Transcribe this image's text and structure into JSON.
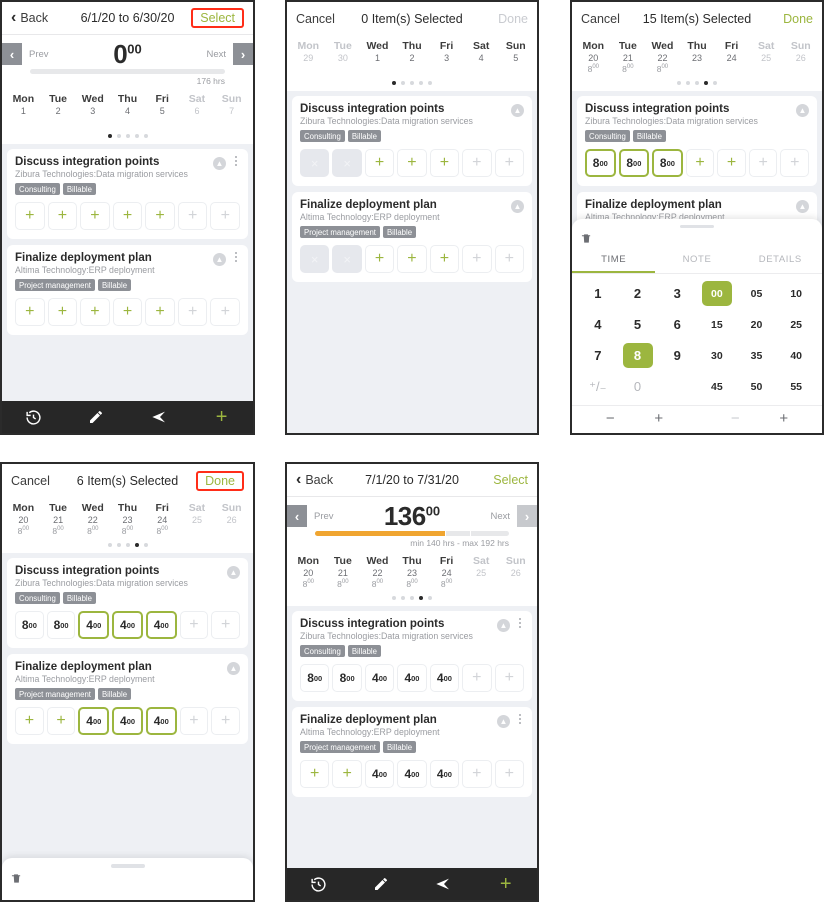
{
  "colors": {
    "accent": "#9cb63f",
    "orange": "#f0a530",
    "gray": "#8d9096",
    "dark": "#272727",
    "highlight": "#ff2d18"
  },
  "tasks": {
    "t1": {
      "title": "Discuss integration points",
      "subtitle": "Zibura Technologies:Data migration services",
      "tags": [
        "Consulting",
        "Billable"
      ]
    },
    "t2": {
      "title": "Finalize deployment plan",
      "subtitle": "Altima Technology:ERP deployment",
      "tags": [
        "Project management",
        "Billable"
      ]
    }
  },
  "panel1": {
    "nav": {
      "back": "Back",
      "title": "6/1/20 to 6/30/20",
      "action": "Select"
    },
    "summary": {
      "prev": "Prev",
      "next": "Next",
      "hours": "0",
      "minutes": "00",
      "caption": "176 hrs",
      "fill_pct": 0
    },
    "weekdays": [
      {
        "day": "Mon",
        "date": "1",
        "hours": "",
        "dim": false
      },
      {
        "day": "Tue",
        "date": "2",
        "hours": "",
        "dim": false
      },
      {
        "day": "Wed",
        "date": "3",
        "hours": "",
        "dim": false
      },
      {
        "day": "Thu",
        "date": "4",
        "hours": "",
        "dim": false
      },
      {
        "day": "Fri",
        "date": "5",
        "hours": "",
        "dim": false
      },
      {
        "day": "Sat",
        "date": "6",
        "hours": "",
        "dim": true
      },
      {
        "day": "Sun",
        "date": "7",
        "hours": "",
        "dim": true
      }
    ],
    "dots": {
      "count": 5,
      "active": 0
    },
    "card1_cells": [
      {
        "type": "plus"
      },
      {
        "type": "plus"
      },
      {
        "type": "plus"
      },
      {
        "type": "plus"
      },
      {
        "type": "plus"
      },
      {
        "type": "plus-mute"
      },
      {
        "type": "plus-mute"
      }
    ],
    "card2_cells": [
      {
        "type": "plus"
      },
      {
        "type": "plus"
      },
      {
        "type": "plus"
      },
      {
        "type": "plus"
      },
      {
        "type": "plus"
      },
      {
        "type": "plus-mute"
      },
      {
        "type": "plus-mute"
      }
    ]
  },
  "panel2": {
    "nav": {
      "cancel": "Cancel",
      "title": "0 Item(s) Selected",
      "done": "Done"
    },
    "weekdays": [
      {
        "day": "Mon",
        "date": "29",
        "hours": "",
        "dim": true
      },
      {
        "day": "Tue",
        "date": "30",
        "hours": "",
        "dim": true
      },
      {
        "day": "Wed",
        "date": "1",
        "hours": "",
        "dim": false
      },
      {
        "day": "Thu",
        "date": "2",
        "hours": "",
        "dim": false
      },
      {
        "day": "Fri",
        "date": "3",
        "hours": "",
        "dim": false
      },
      {
        "day": "Sat",
        "date": "4",
        "hours": "",
        "dim": false
      },
      {
        "day": "Sun",
        "date": "5",
        "hours": "",
        "dim": false
      }
    ],
    "dots": {
      "count": 5,
      "active": 0
    },
    "card1_cells": [
      {
        "type": "disabled",
        "label": "×"
      },
      {
        "type": "disabled",
        "label": "×"
      },
      {
        "type": "plus"
      },
      {
        "type": "plus"
      },
      {
        "type": "plus"
      },
      {
        "type": "plus-mute"
      },
      {
        "type": "plus-mute"
      }
    ],
    "card2_cells": [
      {
        "type": "disabled",
        "label": "×"
      },
      {
        "type": "disabled",
        "label": "×"
      },
      {
        "type": "plus"
      },
      {
        "type": "plus"
      },
      {
        "type": "plus"
      },
      {
        "type": "plus-mute"
      },
      {
        "type": "plus-mute"
      }
    ]
  },
  "panel3": {
    "nav": {
      "cancel": "Cancel",
      "title": "15 Item(s) Selected",
      "done": "Done"
    },
    "weekdays": [
      {
        "day": "Mon",
        "date": "20",
        "hours": "8",
        "mins": "00",
        "dim": false
      },
      {
        "day": "Tue",
        "date": "21",
        "hours": "8",
        "mins": "00",
        "dim": false
      },
      {
        "day": "Wed",
        "date": "22",
        "hours": "8",
        "mins": "00",
        "dim": false
      },
      {
        "day": "Thu",
        "date": "23",
        "hours": "",
        "dim": false
      },
      {
        "day": "Fri",
        "date": "24",
        "hours": "",
        "dim": false
      },
      {
        "day": "Sat",
        "date": "25",
        "hours": "",
        "dim": true
      },
      {
        "day": "Sun",
        "date": "26",
        "hours": "",
        "dim": true
      }
    ],
    "dots": {
      "count": 5,
      "active": 3
    },
    "card1_cells": [
      {
        "type": "value-sel",
        "h": "8",
        "m": "00"
      },
      {
        "type": "value-sel",
        "h": "8",
        "m": "00"
      },
      {
        "type": "value-sel",
        "h": "8",
        "m": "00"
      },
      {
        "type": "plus"
      },
      {
        "type": "plus"
      },
      {
        "type": "plus-mute"
      },
      {
        "type": "plus-mute"
      }
    ],
    "picker": {
      "tabs": [
        {
          "label": "TIME",
          "active": true
        },
        {
          "label": "NOTE",
          "active": false
        },
        {
          "label": "DETAILS",
          "active": false
        }
      ],
      "rows": [
        [
          {
            "l": "1"
          },
          {
            "l": "2"
          },
          {
            "l": "3"
          },
          {
            "l": "00",
            "min": true,
            "sel": true
          },
          {
            "l": "05",
            "min": true
          },
          {
            "l": "10",
            "min": true
          }
        ],
        [
          {
            "l": "4"
          },
          {
            "l": "5"
          },
          {
            "l": "6"
          },
          {
            "l": "15",
            "min": true
          },
          {
            "l": "20",
            "min": true
          },
          {
            "l": "25",
            "min": true
          }
        ],
        [
          {
            "l": "7"
          },
          {
            "l": "8",
            "sel": true
          },
          {
            "l": "9"
          },
          {
            "l": "30",
            "min": true
          },
          {
            "l": "35",
            "min": true
          },
          {
            "l": "40",
            "min": true
          }
        ],
        [
          {
            "l": "⁺/₋",
            "gray": true
          },
          {
            "l": "0",
            "gray": true
          },
          {
            "l": "",
            "blank": true
          },
          {
            "l": "45",
            "min": true
          },
          {
            "l": "50",
            "min": true
          },
          {
            "l": "55",
            "min": true
          }
        ]
      ],
      "steppers": [
        {
          "minus": "−",
          "plus": "+",
          "minus_dim": false
        },
        {
          "minus": "−",
          "plus": "+",
          "minus_dim": true
        }
      ]
    }
  },
  "panel4": {
    "nav": {
      "cancel": "Cancel",
      "title": "6 Item(s) Selected",
      "done": "Done"
    },
    "weekdays": [
      {
        "day": "Mon",
        "date": "20",
        "hours": "8",
        "mins": "00",
        "dim": false
      },
      {
        "day": "Tue",
        "date": "21",
        "hours": "8",
        "mins": "00",
        "dim": false
      },
      {
        "day": "Wed",
        "date": "22",
        "hours": "8",
        "mins": "00",
        "dim": false
      },
      {
        "day": "Thu",
        "date": "23",
        "hours": "8",
        "mins": "00",
        "dim": false
      },
      {
        "day": "Fri",
        "date": "24",
        "hours": "8",
        "mins": "00",
        "dim": false
      },
      {
        "day": "Sat",
        "date": "25",
        "hours": "",
        "dim": true
      },
      {
        "day": "Sun",
        "date": "26",
        "hours": "",
        "dim": true
      }
    ],
    "dots": {
      "count": 5,
      "active": 3
    },
    "card1_cells": [
      {
        "type": "value",
        "h": "8",
        "m": "00"
      },
      {
        "type": "value",
        "h": "8",
        "m": "00"
      },
      {
        "type": "value-sel",
        "h": "4",
        "m": "00"
      },
      {
        "type": "value-sel",
        "h": "4",
        "m": "00"
      },
      {
        "type": "value-sel",
        "h": "4",
        "m": "00"
      },
      {
        "type": "plus-mute"
      },
      {
        "type": "plus-mute"
      }
    ],
    "card2_cells": [
      {
        "type": "plus"
      },
      {
        "type": "plus"
      },
      {
        "type": "value-sel",
        "h": "4",
        "m": "00"
      },
      {
        "type": "value-sel",
        "h": "4",
        "m": "00"
      },
      {
        "type": "value-sel",
        "h": "4",
        "m": "00"
      },
      {
        "type": "plus-mute"
      },
      {
        "type": "plus-mute"
      }
    ]
  },
  "panel5": {
    "nav": {
      "back": "Back",
      "title": "7/1/20 to 7/31/20",
      "action": "Select"
    },
    "summary": {
      "prev": "Prev",
      "next": "Next",
      "hours": "136",
      "minutes": "00",
      "caption": "min 140 hrs - max 192 hrs",
      "fill_pct": 67
    },
    "weekdays": [
      {
        "day": "Mon",
        "date": "20",
        "hours": "8",
        "mins": "00",
        "dim": false
      },
      {
        "day": "Tue",
        "date": "21",
        "hours": "8",
        "mins": "00",
        "dim": false
      },
      {
        "day": "Wed",
        "date": "22",
        "hours": "8",
        "mins": "00",
        "dim": false
      },
      {
        "day": "Thu",
        "date": "23",
        "hours": "8",
        "mins": "00",
        "dim": false
      },
      {
        "day": "Fri",
        "date": "24",
        "hours": "8",
        "mins": "00",
        "dim": false
      },
      {
        "day": "Sat",
        "date": "25",
        "hours": "",
        "dim": true
      },
      {
        "day": "Sun",
        "date": "26",
        "hours": "",
        "dim": true
      }
    ],
    "dots": {
      "count": 5,
      "active": 3
    },
    "card1_cells": [
      {
        "type": "value",
        "h": "8",
        "m": "00"
      },
      {
        "type": "value",
        "h": "8",
        "m": "00"
      },
      {
        "type": "value",
        "h": "4",
        "m": "00"
      },
      {
        "type": "value",
        "h": "4",
        "m": "00"
      },
      {
        "type": "value",
        "h": "4",
        "m": "00"
      },
      {
        "type": "plus-mute"
      },
      {
        "type": "plus-mute"
      }
    ],
    "card2_cells": [
      {
        "type": "plus"
      },
      {
        "type": "plus"
      },
      {
        "type": "value",
        "h": "4",
        "m": "00"
      },
      {
        "type": "value",
        "h": "4",
        "m": "00"
      },
      {
        "type": "value",
        "h": "4",
        "m": "00"
      },
      {
        "type": "plus-mute"
      },
      {
        "type": "plus-mute"
      }
    ]
  },
  "bottomnav": {
    "items": [
      "history-icon",
      "pencil-icon",
      "send-icon",
      "plus-icon"
    ]
  }
}
